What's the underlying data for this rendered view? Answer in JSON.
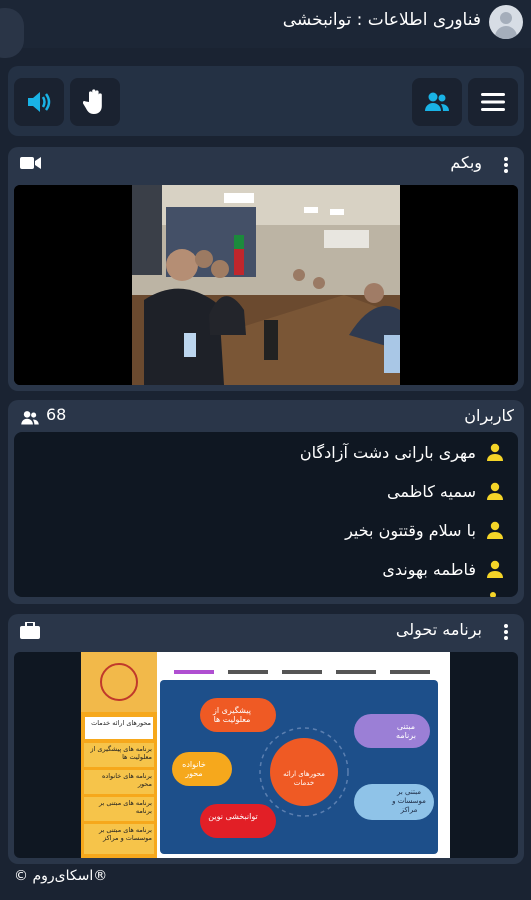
{
  "header": {
    "title": "فناوری اطلاعات : توانبخشی",
    "avatar_icon": "user-avatar-icon",
    "recording_color": "#d6303b"
  },
  "toolbar": {
    "menu_icon": "hamburger-menu-icon",
    "users_icon": "users-icon",
    "raise_hand_icon": "hand-icon",
    "speaker_icon": "speaker-icon",
    "accent_color": "#19b3e6"
  },
  "webcam": {
    "title": "وبکم",
    "icon": "video-camera-icon",
    "content": "meeting-room-video"
  },
  "users": {
    "title": "کاربران",
    "count": "68",
    "icon": "users-icon",
    "items": [
      {
        "name": "مهری بارانی دشت آزادگان"
      },
      {
        "name": "سمیه کاظمی"
      },
      {
        "name": "با سلام وقتتون بخیر"
      },
      {
        "name": "فاطمه بهوندی"
      }
    ]
  },
  "presentation": {
    "title": "برنامه تحولی",
    "icon": "briefcase-icon",
    "slide": {
      "sidebar": [
        "محورهای ارائه خدمات",
        "برنامه های پیشگیری از معلولیت ها",
        "برنامه های خانواده محور",
        "برنامه های مبتنی بر برنامه",
        "برنامه های مبتنی بر موسسات و مراکز"
      ],
      "center": "محورهای ارائه خدمات",
      "nodes": [
        "پیشگیری از معلولیت ها",
        "خانواده محور",
        "توانبخشی نوین",
        "مبتنی برنامه",
        "مبتنی بر موسسات و مراکز"
      ]
    }
  },
  "footer": {
    "brand": "®اسکای‌روم ©"
  }
}
